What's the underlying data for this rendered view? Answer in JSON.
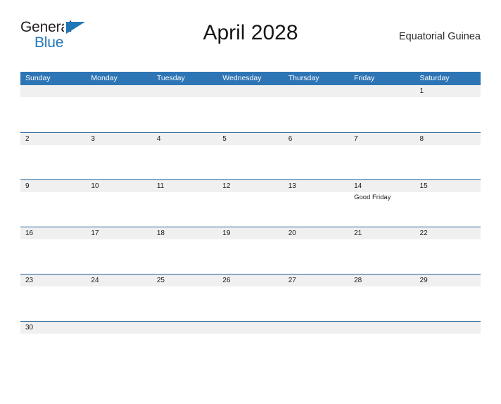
{
  "brand": {
    "name_part1": "General",
    "name_part2": "Blue",
    "triangle_icon": "triangle-icon"
  },
  "header": {
    "month_title": "April 2028",
    "locale": "Equatorial Guinea"
  },
  "colors": {
    "header_blue": "#2e75b6",
    "rule_blue": "#1f6095",
    "daynum_band": "#f0f0f0",
    "brand_blue": "#2176b8",
    "text_dark": "#1b1b1b"
  },
  "calendar": {
    "weekdays": [
      "Sunday",
      "Monday",
      "Tuesday",
      "Wednesday",
      "Thursday",
      "Friday",
      "Saturday"
    ],
    "weeks": [
      [
        {
          "day": ""
        },
        {
          "day": ""
        },
        {
          "day": ""
        },
        {
          "day": ""
        },
        {
          "day": ""
        },
        {
          "day": ""
        },
        {
          "day": "1"
        }
      ],
      [
        {
          "day": "2"
        },
        {
          "day": "3"
        },
        {
          "day": "4"
        },
        {
          "day": "5"
        },
        {
          "day": "6"
        },
        {
          "day": "7"
        },
        {
          "day": "8"
        }
      ],
      [
        {
          "day": "9"
        },
        {
          "day": "10"
        },
        {
          "day": "11"
        },
        {
          "day": "12"
        },
        {
          "day": "13"
        },
        {
          "day": "14",
          "event": "Good Friday"
        },
        {
          "day": "15"
        }
      ],
      [
        {
          "day": "16"
        },
        {
          "day": "17"
        },
        {
          "day": "18"
        },
        {
          "day": "19"
        },
        {
          "day": "20"
        },
        {
          "day": "21"
        },
        {
          "day": "22"
        }
      ],
      [
        {
          "day": "23"
        },
        {
          "day": "24"
        },
        {
          "day": "25"
        },
        {
          "day": "26"
        },
        {
          "day": "27"
        },
        {
          "day": "28"
        },
        {
          "day": "29"
        }
      ],
      [
        {
          "day": "30"
        },
        {
          "day": ""
        },
        {
          "day": ""
        },
        {
          "day": ""
        },
        {
          "day": ""
        },
        {
          "day": ""
        },
        {
          "day": ""
        }
      ]
    ]
  }
}
